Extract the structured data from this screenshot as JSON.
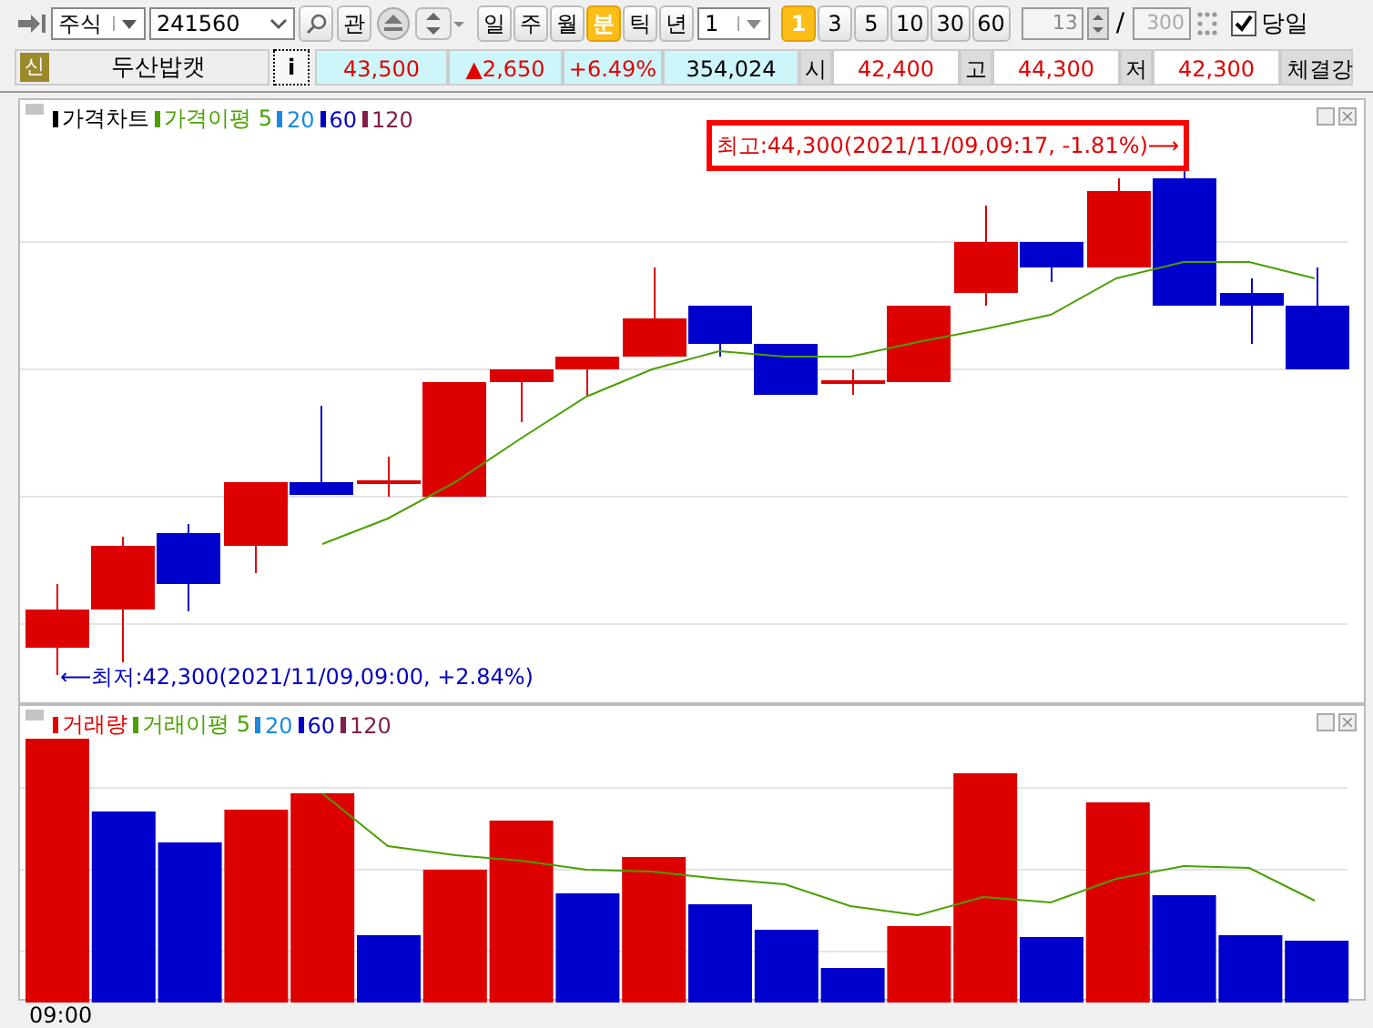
{
  "toolbar": {
    "market": "주식",
    "code": "241560",
    "watch_button": "관",
    "periods": [
      {
        "label": "일",
        "selected": false
      },
      {
        "label": "주",
        "selected": false
      },
      {
        "label": "월",
        "selected": false
      },
      {
        "label": "분",
        "selected": true
      },
      {
        "label": "틱",
        "selected": false
      },
      {
        "label": "년",
        "selected": false
      }
    ],
    "interval": "1",
    "intervals": [
      {
        "label": "1",
        "selected": true
      },
      {
        "label": "3",
        "selected": false
      },
      {
        "label": "5",
        "selected": false
      },
      {
        "label": "10",
        "selected": false
      },
      {
        "label": "30",
        "selected": false
      },
      {
        "label": "60",
        "selected": false
      }
    ],
    "count": "13",
    "separator": "/",
    "max_count": "300",
    "today": {
      "label": "당일",
      "checked": true
    }
  },
  "quote": {
    "badge": "신",
    "name": "두산밥캣",
    "info_button": "i",
    "price": "43,500",
    "change": "▲2,650",
    "rate": "+6.49%",
    "volume": "354,024",
    "fields": [
      {
        "label": "시",
        "value": "42,400"
      },
      {
        "label": "고",
        "value": "44,300"
      },
      {
        "label": "저",
        "value": "42,300"
      }
    ],
    "tail": "체결강"
  },
  "price_panel": {
    "legend": [
      {
        "label": "가격차트",
        "color": "#000000"
      },
      {
        "label": "가격이평 5",
        "color": "#4aa000"
      },
      {
        "label": "20",
        "color": "#1a8ae0"
      },
      {
        "label": "60",
        "color": "#0000c0"
      },
      {
        "label": "120",
        "color": "#80204a"
      }
    ],
    "high_note": "최고:44,300(2021/11/09,09:17, -1.81%)⟶",
    "low_note": "⟵최저:42,300(2021/11/09,09:00, +2.84%)"
  },
  "volume_panel": {
    "legend": [
      {
        "label": "거래량",
        "color": "#e00000"
      },
      {
        "label": "거래이평 5",
        "color": "#4aa000"
      },
      {
        "label": "20",
        "color": "#1a8ae0"
      },
      {
        "label": "60",
        "color": "#0000c0"
      },
      {
        "label": "120",
        "color": "#80204a"
      }
    ]
  },
  "time_axis": [
    "09:00"
  ]
}
